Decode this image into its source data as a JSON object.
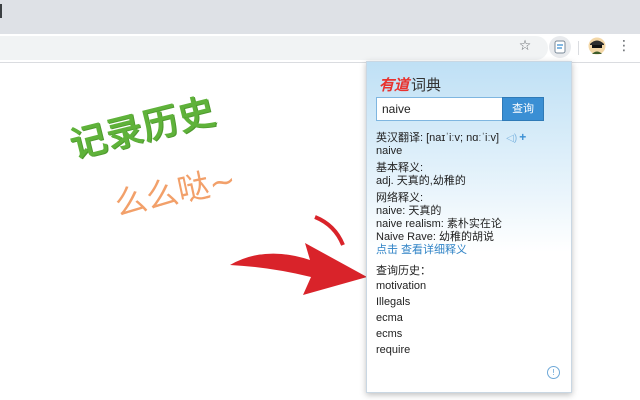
{
  "browser": {
    "star_icon": "star-icon",
    "menu_icon": "more-vert-icon"
  },
  "promo": {
    "title": "记录历史",
    "subtitle": "么么哒~",
    "title_color": "#5fb23a",
    "subtitle_color": "#f2a06a",
    "arrow_color": "#d9232a"
  },
  "popup": {
    "brand": "有道",
    "brand_suffix": "词典",
    "input_value": "naive",
    "search_label": "查询",
    "sections": {
      "translation_label": "英汉翻译: [naɪˈiːv; nɑːˈiːv]",
      "word": "naive",
      "basic_label": "基本释义:",
      "basic_def": "adj. 天真的,幼稚的",
      "web_label": "网络释义:",
      "web_defs": [
        "naive: 天真的",
        "naive realism: 素朴实在论",
        "Naive Rave: 幼稚的胡说"
      ],
      "detail_link": "点击 查看详细释义"
    },
    "history_label": "查询历史：",
    "history": [
      "motivation",
      "Illegals",
      "ecma",
      "ecms",
      "require"
    ],
    "accent_color": "#3a8fd4"
  }
}
